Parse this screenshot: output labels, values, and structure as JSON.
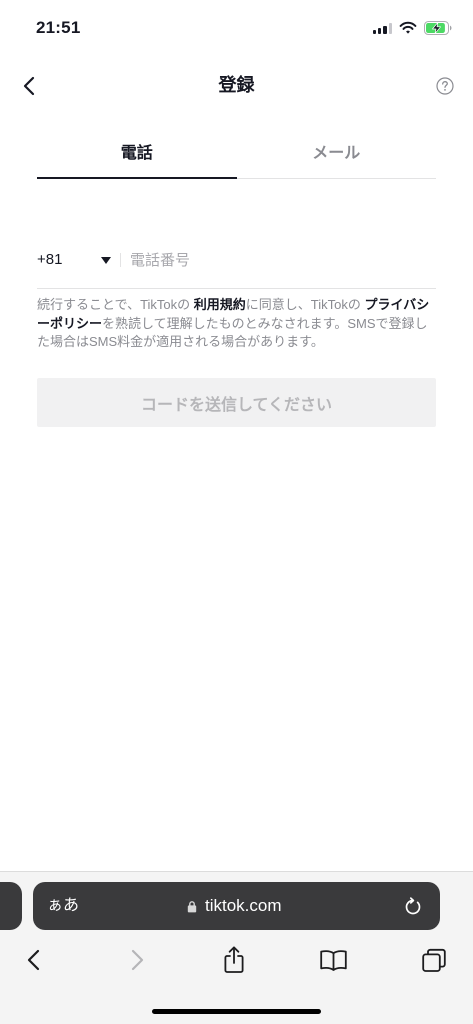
{
  "status_bar": {
    "time": "21:51",
    "signal_level": 3,
    "wifi_icon": "wifi-icon",
    "battery": {
      "level": 0.9,
      "charging": true
    }
  },
  "header": {
    "title": "登録",
    "back_icon": "chevron-left-icon",
    "help_icon": "question-circle-icon"
  },
  "tabs": [
    {
      "label": "電話",
      "active": true
    },
    {
      "label": "メール",
      "active": false
    }
  ],
  "phone_form": {
    "country_code": "+81",
    "dropdown_icon": "caret-down-icon",
    "placeholder": "電話番号",
    "value": ""
  },
  "terms": {
    "text_1": "続行することで、TikTokの ",
    "terms_link": "利用規約",
    "text_2": "に同意し、TikTokの ",
    "privacy_link": "プライバシーポリシー",
    "text_3": "を熟読して理解したものとみなされます。SMSで登録した場合はSMS料金が適用される場合があります。"
  },
  "submit_button": {
    "label": "コードを送信してください",
    "enabled": false
  },
  "browser": {
    "text_size_label": "ぁあ",
    "url": "tiktok.com",
    "secure": true,
    "lock_icon": "lock-icon",
    "reload_icon": "reload-icon",
    "toolbar": [
      {
        "icon": "chevron-left-icon",
        "enabled": true
      },
      {
        "icon": "chevron-right-icon",
        "enabled": false
      },
      {
        "icon": "share-icon",
        "enabled": true
      },
      {
        "icon": "bookmarks-icon",
        "enabled": true
      },
      {
        "icon": "tabs-icon",
        "enabled": true
      }
    ]
  },
  "colors": {
    "text_primary": "#161823",
    "text_secondary": "#8a8b91",
    "placeholder": "#a8a8ad",
    "divider": "#e3e3e4",
    "button_disabled_bg": "#f1f1f2",
    "button_disabled_text": "#b6b6b9",
    "battery_green": "#4cd964",
    "address_bar_bg": "#3a3a3c"
  }
}
